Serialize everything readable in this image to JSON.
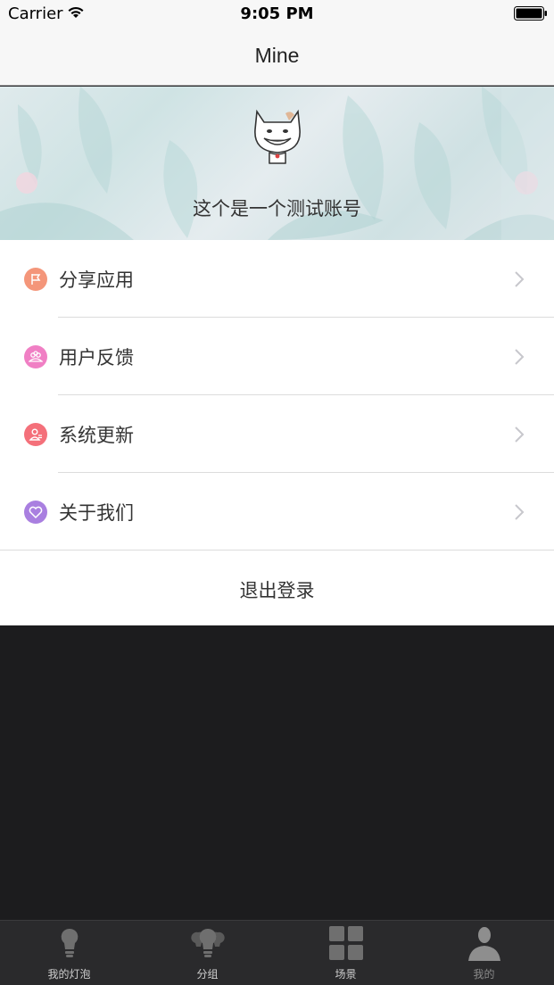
{
  "status_bar": {
    "carrier": "Carrier",
    "time": "9:05 PM"
  },
  "nav": {
    "title": "Mine"
  },
  "profile": {
    "username": "这个是一个测试账号"
  },
  "menu": {
    "items": [
      {
        "label": "分享应用",
        "icon": "share-flag-icon",
        "color": "#f4967a"
      },
      {
        "label": "用户反馈",
        "icon": "feedback-group-icon",
        "color": "#f07fc4"
      },
      {
        "label": "系统更新",
        "icon": "update-user-icon",
        "color": "#f4707a"
      },
      {
        "label": "关于我们",
        "icon": "heart-icon",
        "color": "#a97fe0"
      }
    ],
    "logout_label": "退出登录"
  },
  "tabs": [
    {
      "label": "我的灯泡",
      "icon": "bulb-icon"
    },
    {
      "label": "分组",
      "icon": "bulb-group-icon"
    },
    {
      "label": "场景",
      "icon": "grid-icon"
    },
    {
      "label": "我的",
      "icon": "person-icon",
      "active": true
    }
  ],
  "colors": {
    "nav_bg": "#f7f7f7",
    "dark_bg": "#1c1c1e",
    "tab_bar_bg": "#2a2a2c",
    "tab_icon": "#6f6f6f",
    "tab_icon_active": "#8e8e8e"
  }
}
